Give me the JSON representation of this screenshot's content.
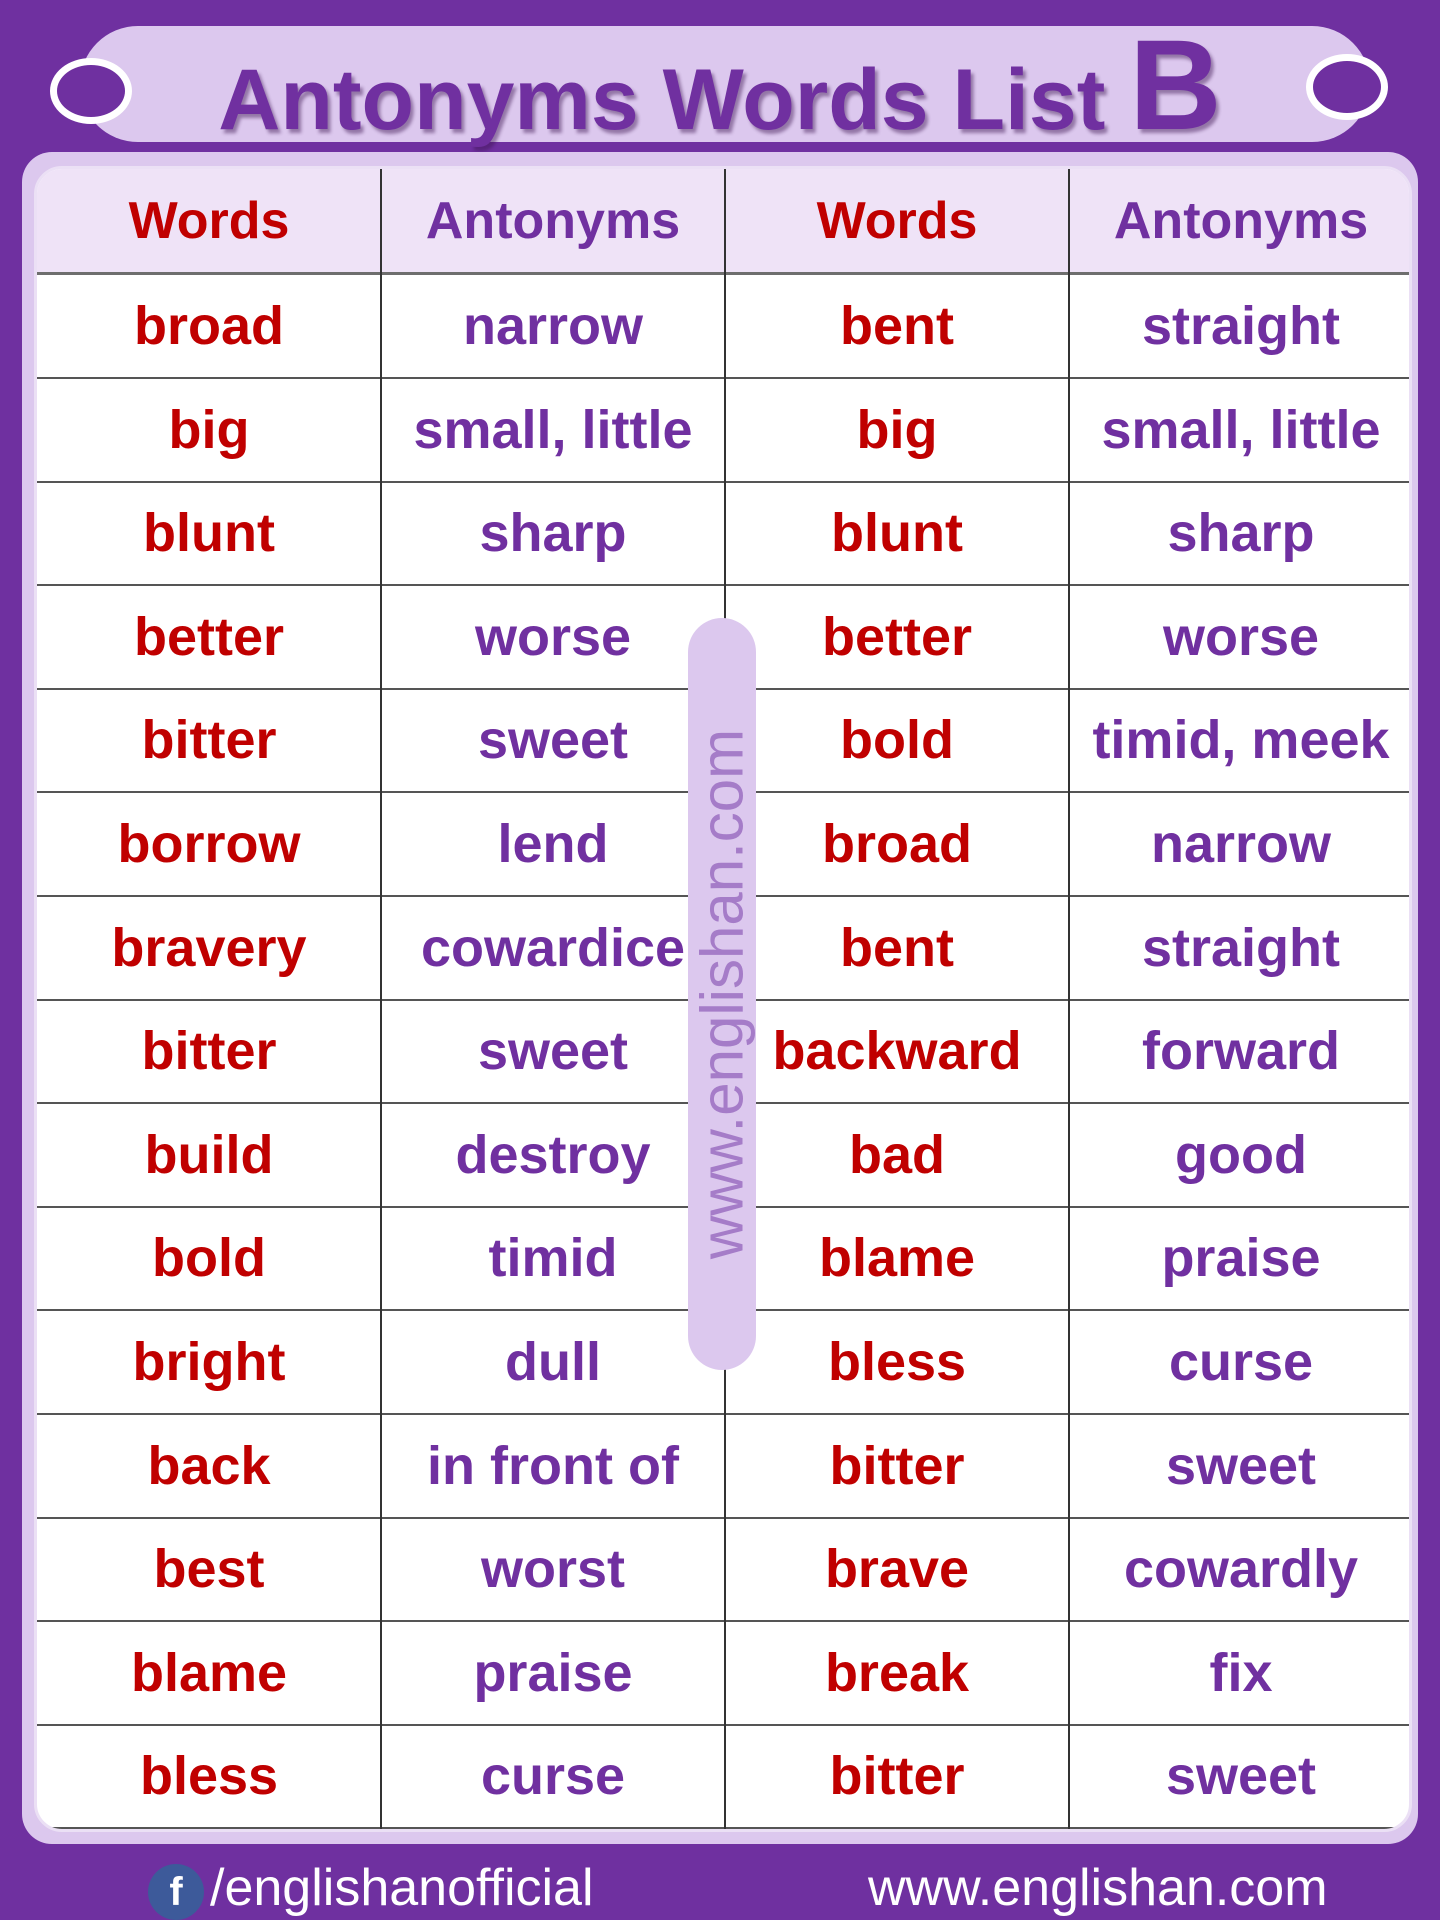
{
  "title": {
    "text": "Antonyms Words  List ",
    "letter": "B"
  },
  "table": {
    "headers": [
      "Words",
      "Antonyms",
      "Words",
      "Antonyms"
    ],
    "rows": [
      [
        "broad",
        "narrow",
        "bent",
        "straight"
      ],
      [
        "big",
        "small, little",
        "big",
        "small, little"
      ],
      [
        "blunt",
        "sharp",
        "blunt",
        "sharp"
      ],
      [
        "better",
        "worse",
        "better",
        "worse"
      ],
      [
        "bitter",
        "sweet",
        "bold",
        "timid, meek"
      ],
      [
        "borrow",
        "lend",
        "broad",
        "narrow"
      ],
      [
        "bravery",
        "cowardice",
        "bent",
        "straight"
      ],
      [
        "bitter",
        "sweet",
        "backward",
        "forward"
      ],
      [
        "build",
        "destroy",
        "bad",
        "good"
      ],
      [
        "bold",
        "timid",
        "blame",
        "praise"
      ],
      [
        "bright",
        "dull",
        "bless",
        "curse"
      ],
      [
        "back",
        "in front of",
        "bitter",
        "sweet"
      ],
      [
        "best",
        "worst",
        "brave",
        "cowardly"
      ],
      [
        "blame",
        "praise",
        "break",
        "fix"
      ],
      [
        "bless",
        "curse",
        "bitter",
        "sweet"
      ]
    ]
  },
  "watermark": "www.englishan.com",
  "footer": {
    "facebook_icon": "facebook-icon",
    "facebook_glyph": "f",
    "facebook_handle": "/englishanofficial",
    "website": "www.englishan.com"
  },
  "colors": {
    "background": "#6f30a0",
    "panel": "#dcc8ee",
    "word": "#c00000",
    "antonym": "#7030a0"
  }
}
